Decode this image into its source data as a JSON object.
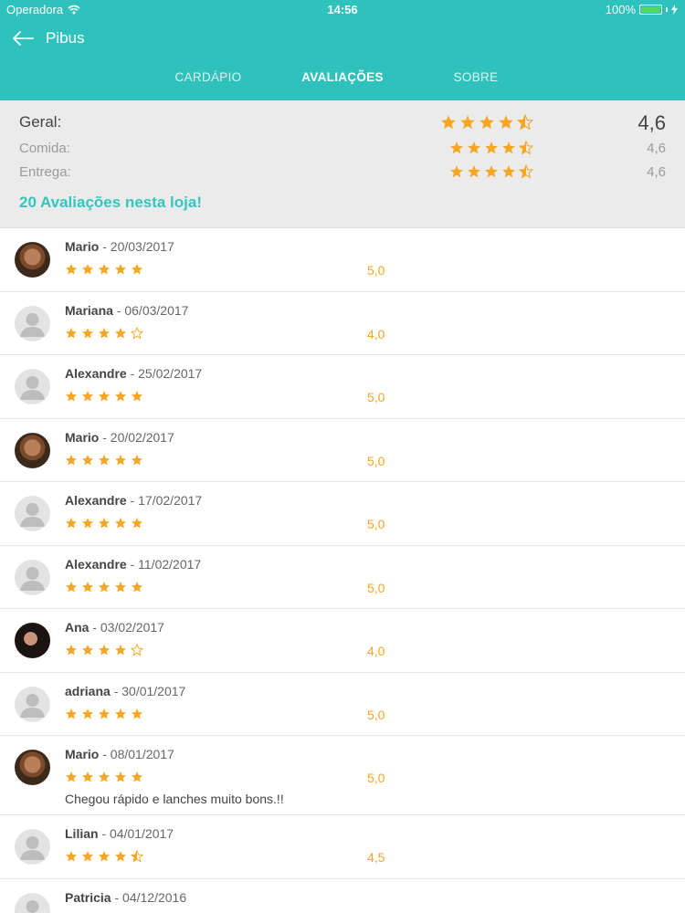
{
  "status_bar": {
    "carrier": "Operadora",
    "time": "14:56",
    "battery": "100%"
  },
  "nav": {
    "title": "Pibus"
  },
  "tabs": [
    {
      "label": "CARDÁPIO",
      "active": false
    },
    {
      "label": "AVALIAÇÕES",
      "active": true
    },
    {
      "label": "SOBRE",
      "active": false
    }
  ],
  "summary": {
    "general": {
      "label": "Geral:",
      "value": "4,6",
      "rating": 4.5
    },
    "food": {
      "label": "Comida:",
      "value": "4,6",
      "rating": 4.5
    },
    "delivery": {
      "label": "Entrega:",
      "value": "4,6",
      "rating": 4.5
    },
    "total_text": "20 Avaliações nesta loja!"
  },
  "reviews": [
    {
      "name": "Mario",
      "date": "- 20/03/2017",
      "rating_text": "5,0",
      "stars": 5,
      "avatar": "photo-m",
      "comment": ""
    },
    {
      "name": "Mariana",
      "date": "- 06/03/2017",
      "rating_text": "4,0",
      "stars": 4,
      "avatar": "default",
      "comment": ""
    },
    {
      "name": "Alexandre",
      "date": "- 25/02/2017",
      "rating_text": "5,0",
      "stars": 5,
      "avatar": "default",
      "comment": ""
    },
    {
      "name": "Mario",
      "date": "- 20/02/2017",
      "rating_text": "5,0",
      "stars": 5,
      "avatar": "photo-m",
      "comment": ""
    },
    {
      "name": "Alexandre",
      "date": "- 17/02/2017",
      "rating_text": "5,0",
      "stars": 5,
      "avatar": "default",
      "comment": ""
    },
    {
      "name": "Alexandre",
      "date": "- 11/02/2017",
      "rating_text": "5,0",
      "stars": 5,
      "avatar": "default",
      "comment": ""
    },
    {
      "name": "Ana",
      "date": "- 03/02/2017",
      "rating_text": "4,0",
      "stars": 4,
      "avatar": "photo-f",
      "comment": ""
    },
    {
      "name": "adriana",
      "date": "- 30/01/2017",
      "rating_text": "5,0",
      "stars": 5,
      "avatar": "default",
      "comment": ""
    },
    {
      "name": "Mario",
      "date": "- 08/01/2017",
      "rating_text": "5,0",
      "stars": 5,
      "avatar": "photo-m",
      "comment": "Chegou rápido e lanches muito bons.!!"
    },
    {
      "name": "Lilian",
      "date": "- 04/01/2017",
      "rating_text": "4,5",
      "stars": 4.5,
      "avatar": "default",
      "comment": ""
    },
    {
      "name": "Patricia",
      "date": "- 04/12/2016",
      "rating_text": "",
      "stars": 0,
      "avatar": "default",
      "comment": ""
    }
  ],
  "colors": {
    "header": "#2fc2bc",
    "accent_text": "#35c5bf",
    "star": "#f5a623",
    "summary_bg": "#ebebeb"
  },
  "icons": {
    "back": "arrow-left-icon",
    "wifi": "wifi-icon",
    "battery": "battery-icon",
    "star": "star-icon",
    "avatar_default": "person-silhouette-icon"
  }
}
